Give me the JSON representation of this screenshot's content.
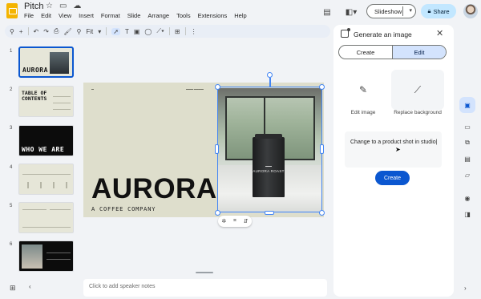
{
  "app": {
    "title": "Pitch",
    "menu": [
      "File",
      "Edit",
      "View",
      "Insert",
      "Format",
      "Slide",
      "Arrange",
      "Tools",
      "Extensions",
      "Help"
    ],
    "slideshow_label": "Slideshow",
    "share_label": "Share"
  },
  "toolbar": {
    "zoom": "Fit"
  },
  "filmstrip": [
    {
      "num": "1",
      "title": "AURORA",
      "style": "light",
      "selected": true
    },
    {
      "num": "2",
      "title": "TABLE OF CONTENTS",
      "style": "light",
      "selected": false
    },
    {
      "num": "3",
      "title": "WHO WE ARE",
      "style": "dark",
      "selected": false
    },
    {
      "num": "4",
      "title": "",
      "style": "light",
      "selected": false
    },
    {
      "num": "5",
      "title": "",
      "style": "light",
      "selected": false
    },
    {
      "num": "6",
      "title": "",
      "style": "dark",
      "selected": false
    }
  ],
  "slide": {
    "title": "AURORA",
    "subtitle": "A COFFEE COMPANY",
    "bag_label": "AURORA ROAST"
  },
  "notes_placeholder": "Click to add speaker notes",
  "panel": {
    "title": "Generate an image",
    "tabs": [
      "Create",
      "Edit"
    ],
    "active_tab": "Edit",
    "option_edit": "Edit image",
    "option_replace": "Replace background",
    "prompt_text": "Change to a product shot in studio",
    "create_label": "Create"
  },
  "colors": {
    "accent": "#0b57d0",
    "selection": "#4285f4",
    "share_bg": "#c2e7ff",
    "slide_bg": "#dedecc"
  }
}
